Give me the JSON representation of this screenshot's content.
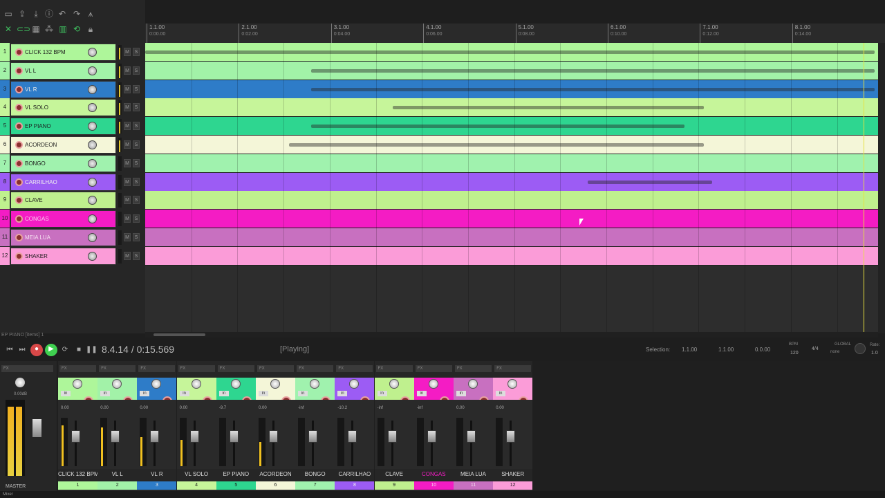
{
  "ruler": [
    {
      "bar": "1.1.00",
      "time": "0:00.00"
    },
    {
      "bar": "2.1.00",
      "time": "0:02.00"
    },
    {
      "bar": "3.1.00",
      "time": "0:04.00"
    },
    {
      "bar": "4.1.00",
      "time": "0:06.00"
    },
    {
      "bar": "5.1.00",
      "time": "0:08.00"
    },
    {
      "bar": "6.1.00",
      "time": "0:10.00"
    },
    {
      "bar": "7.1.00",
      "time": "0:12.00"
    },
    {
      "bar": "8.1.00",
      "time": "0:14.00"
    }
  ],
  "tracks": [
    {
      "num": "1",
      "name": "CLICK 132 BPM",
      "color": "#aef69a",
      "fg": "#1c1c1c"
    },
    {
      "num": "2",
      "name": "VL L",
      "color": "#a2f2a8",
      "fg": "#1c1c1c"
    },
    {
      "num": "3",
      "name": "VL R",
      "color": "#2e7cc8",
      "fg": "#e8e8e8"
    },
    {
      "num": "4",
      "name": "VL SOLO",
      "color": "#c6f59a",
      "fg": "#1c1c1c"
    },
    {
      "num": "5",
      "name": "EP PIANO",
      "color": "#2ed690",
      "fg": "#1c1c1c"
    },
    {
      "num": "6",
      "name": "ACORDEON",
      "color": "#f4f6d8",
      "fg": "#1c1c1c"
    },
    {
      "num": "7",
      "name": "BONGO",
      "color": "#a0f2ae",
      "fg": "#1c1c1c"
    },
    {
      "num": "8",
      "name": "CARRILHAO",
      "color": "#9c5cf4",
      "fg": "#f0f0f0"
    },
    {
      "num": "9",
      "name": "CLAVE",
      "color": "#bff08e",
      "fg": "#1c1c1c"
    },
    {
      "num": "10",
      "name": "CONGAS",
      "color": "#f41cc4",
      "fg": "#f8d0f0"
    },
    {
      "num": "11",
      "name": "MEIA LUA",
      "color": "#c870c0",
      "fg": "#f6e0f0"
    },
    {
      "num": "12",
      "name": "SHAKER",
      "color": "#fb9cd8",
      "fg": "#1c1c1c"
    }
  ],
  "status": {
    "left": "EP PIANO [items] 1"
  },
  "transport": {
    "position": "8.4.14 / 0:15.569",
    "state": "[Playing]",
    "selection_label": "Selection:",
    "sel_start": "1.1.00",
    "sel_end": "1.1.00",
    "sel_len": "0.0.00",
    "bpm_label": "BPM",
    "bpm": "120",
    "timesig": "4/4",
    "global_label": "GLOBAL",
    "global_val": "none",
    "rate_label": "Rate:",
    "rate": "1.0"
  },
  "mixer": {
    "master_label": "MASTER",
    "master_db": "0.00dB",
    "strips": [
      {
        "name": "CLICK 132 BPM",
        "num": "1",
        "vol": "0.00",
        "color": "#aef69a",
        "fg": "#1c1c1c",
        "meter": 0.85
      },
      {
        "name": "VL L",
        "num": "2",
        "vol": "0.00",
        "color": "#a2f2a8",
        "fg": "#1c1c1c",
        "meter": 0.8
      },
      {
        "name": "VL R",
        "num": "3",
        "vol": "0.00",
        "color": "#2e7cc8",
        "fg": "#e8e8e8",
        "meter": 0.6
      },
      {
        "name": "VL SOLO",
        "num": "4",
        "vol": "0.00",
        "color": "#c6f59a",
        "fg": "#1c1c1c",
        "meter": 0.55
      },
      {
        "name": "EP PIANO",
        "num": "5",
        "vol": "-9.7",
        "color": "#2ed690",
        "fg": "#1c1c1c",
        "meter": 0.0
      },
      {
        "name": "ACORDEON",
        "num": "6",
        "vol": "0.00",
        "color": "#f4f6d8",
        "fg": "#1c1c1c",
        "meter": 0.5
      },
      {
        "name": "BONGO",
        "num": "7",
        "vol": "-inf",
        "color": "#a0f2ae",
        "fg": "#1c1c1c",
        "meter": 0.0
      },
      {
        "name": "CARRILHAO",
        "num": "8",
        "vol": "-10.2",
        "color": "#9c5cf4",
        "fg": "#f0f0f0",
        "meter": 0.0
      },
      {
        "name": "CLAVE",
        "num": "9",
        "vol": "-inf",
        "color": "#bff08e",
        "fg": "#1c1c1c",
        "meter": 0.0
      },
      {
        "name": "CONGAS",
        "num": "10",
        "vol": "-inf",
        "color": "#f41cc4",
        "fg": "#f8d0f0",
        "meter": 0.0
      },
      {
        "name": "MEIA LUA",
        "num": "11",
        "vol": "0.00",
        "color": "#c870c0",
        "fg": "#f6e0f0",
        "meter": 0.0
      },
      {
        "name": "SHAKER",
        "num": "12",
        "vol": "0.00",
        "color": "#fb9cd8",
        "fg": "#1c1c1c",
        "meter": 0.0
      }
    ]
  },
  "icons": {
    "new": "new-project-icon",
    "open": "open-project-icon",
    "save": "save-project-icon",
    "info": "project-info-icon",
    "undo": "undo-icon",
    "redo": "redo-icon",
    "metronome": "metronome-icon"
  },
  "bottom": {
    "tab": "Mixer"
  }
}
